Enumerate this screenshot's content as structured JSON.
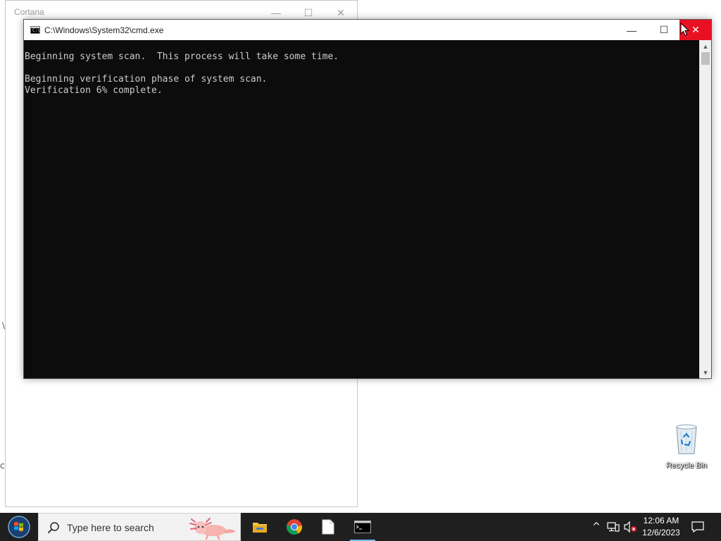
{
  "cortana": {
    "title": "Cortana",
    "minimize": "—",
    "maximize": "☐",
    "close": "✕",
    "side_glyphs": [
      "\\",
      "c"
    ]
  },
  "cmd": {
    "title": "C:\\Windows\\System32\\cmd.exe",
    "icon_text": "C:\\_",
    "minimize": "—",
    "maximize": "☐",
    "close": "✕",
    "lines": [
      "Beginning system scan.  This process will take some time.",
      "",
      "Beginning verification phase of system scan.",
      "Verification 6% complete."
    ],
    "scroll_up": "▲",
    "scroll_down": "▼"
  },
  "desktop": {
    "recycle_bin_label": "Recycle Bin"
  },
  "taskbar": {
    "search_placeholder": "Type here to search",
    "apps": [
      "file-explorer",
      "chrome",
      "blank-document",
      "command-prompt"
    ],
    "tray": {
      "chevron": "^",
      "clock_time": "12:06 AM",
      "clock_date": "12/6/2023"
    }
  },
  "colors": {
    "close_red": "#e81123",
    "console_bg": "#0c0c0c",
    "console_fg": "#cccccc",
    "taskbar_bg": "#1f1f1f",
    "active_indicator": "#76b9ed"
  }
}
